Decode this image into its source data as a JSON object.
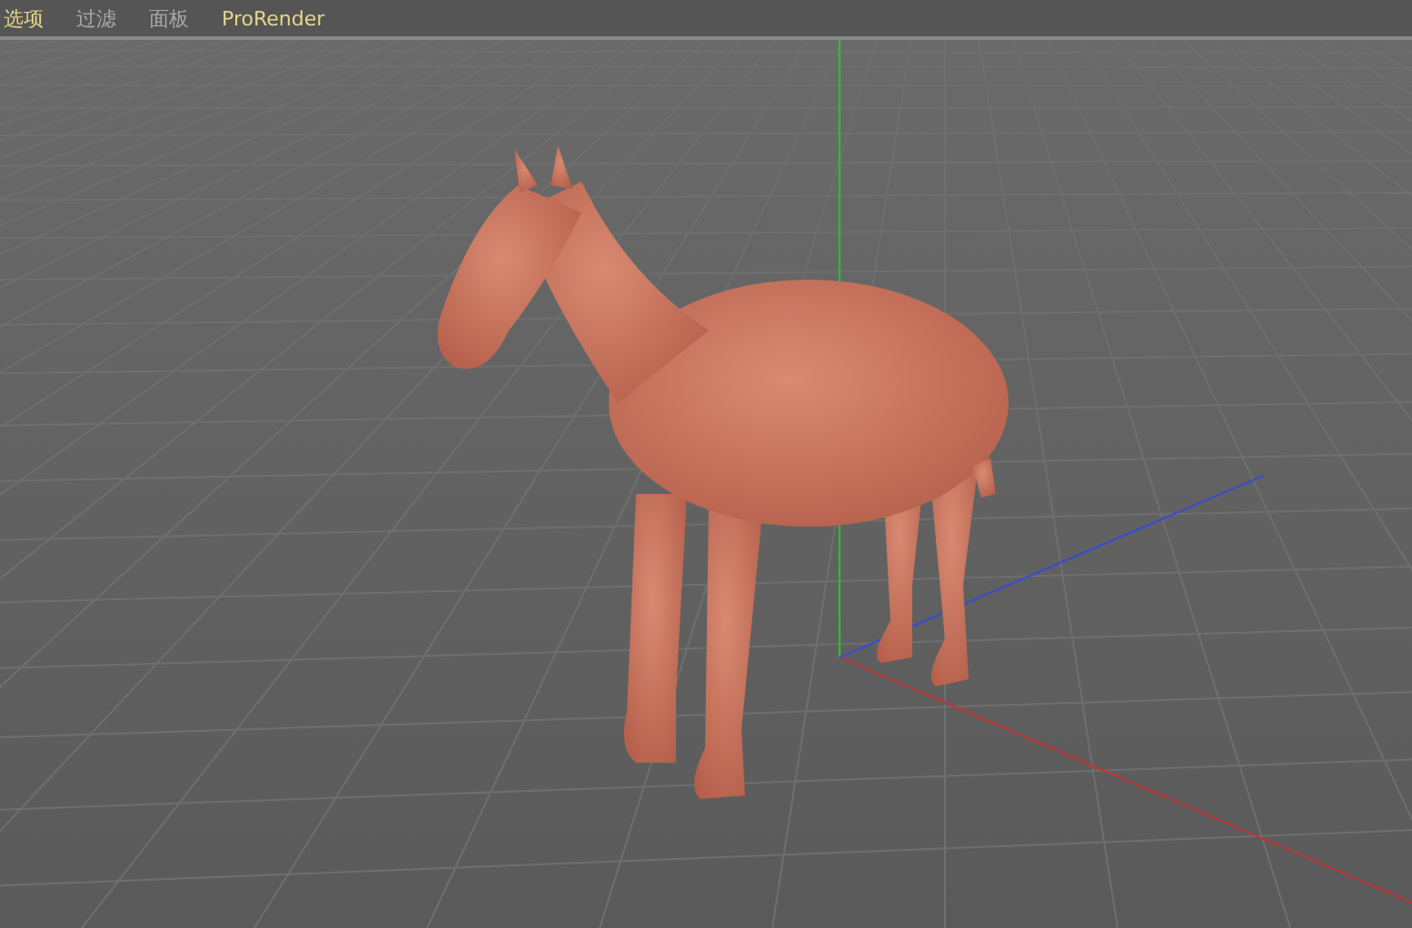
{
  "menu": [
    {
      "label": "选项",
      "highlighted": true
    },
    {
      "label": "过滤",
      "highlighted": false
    },
    {
      "label": "面板",
      "highlighted": false
    },
    {
      "label": "ProRender",
      "highlighted": true
    }
  ]
}
